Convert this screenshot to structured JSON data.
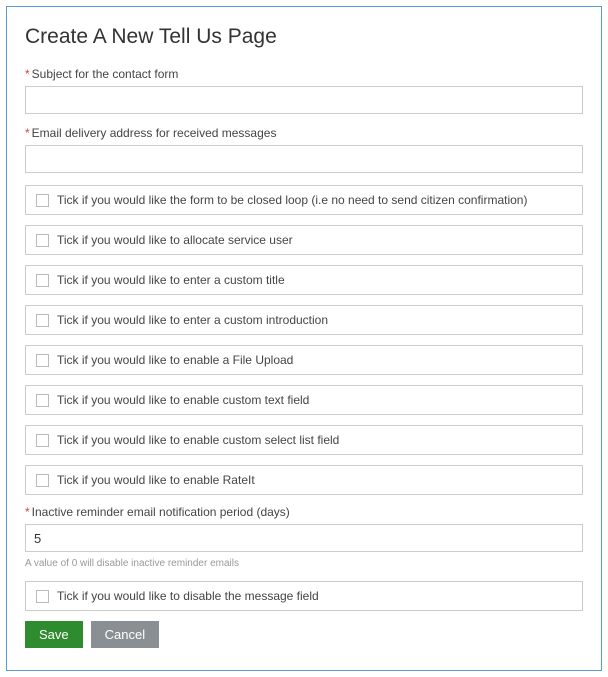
{
  "title": "Create A New Tell Us Page",
  "fields": {
    "subject": {
      "label": "Subject for the contact form",
      "value": ""
    },
    "deliveryEmail": {
      "label": "Email delivery address for received messages",
      "value": ""
    },
    "inactivePeriod": {
      "label": "Inactive reminder email notification period (days)",
      "value": "5",
      "hint": "A value of 0 will disable inactive reminder emails"
    }
  },
  "checkboxes": {
    "closedLoop": "Tick if you would like the form to be closed loop (i.e no need to send citizen confirmation)",
    "allocateUser": "Tick if you would like to allocate service user",
    "customTitle": "Tick if you would like to enter a custom title",
    "customIntro": "Tick if you would like to enter a custom introduction",
    "fileUpload": "Tick if you would like to enable a File Upload",
    "customText": "Tick if you would like to enable custom text field",
    "customSelect": "Tick if you would like to enable custom select list field",
    "rateIt": "Tick if you would like to enable RateIt",
    "disableMessage": "Tick if you would like to disable the message field"
  },
  "buttons": {
    "save": "Save",
    "cancel": "Cancel"
  }
}
